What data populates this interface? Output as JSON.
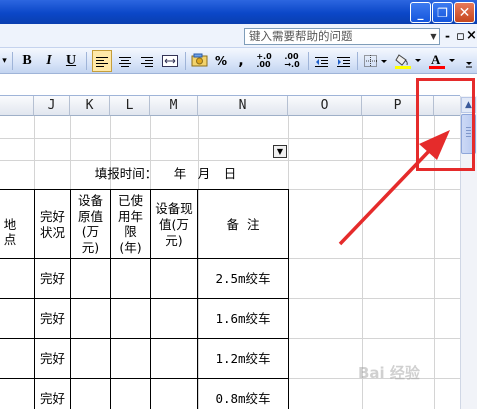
{
  "window": {
    "minimize_glyph": "_",
    "restore_glyph": "❐",
    "close_glyph": "✕"
  },
  "menu": {
    "help_placeholder": "键入需要帮助的问题",
    "help_dropdown": "▼",
    "doc_minimize": "-",
    "doc_restore": "▫",
    "doc_close": "×"
  },
  "toolbar": {
    "left_arrow": "▾",
    "bold": "B",
    "italic": "I",
    "underline": "U",
    "percent": "%",
    "comma": ",",
    "increase_decimal": "+.0\n.00",
    "decrease_decimal": ".00\n→.0",
    "font_color_letter": "A",
    "highlight_color": "#ffff00",
    "font_color": "#ff0000"
  },
  "columns": [
    "J",
    "K",
    "L",
    "M",
    "N",
    "O",
    "P"
  ],
  "sheet": {
    "fill_time_label": "填报时间：",
    "year": "年",
    "month": "月",
    "day": "日",
    "filter_arrow": "▼",
    "headers": {
      "location_fragment": "地点",
      "condition": "完好\n状况",
      "original_value": "设备\n原值\n(万\n元)",
      "years_used": "已使\n用年\n限\n(年)",
      "current_value": "设备现\n值(万\n元)",
      "remarks": "备  注"
    },
    "rows": [
      {
        "condition": "完好",
        "remark": "2.5m绞车"
      },
      {
        "condition": "完好",
        "remark": "1.6m绞车"
      },
      {
        "condition": "完好",
        "remark": "1.2m绞车"
      },
      {
        "condition": "完好",
        "remark": "0.8m绞车"
      }
    ]
  },
  "scrollbar": {
    "up_arrow": "▲"
  },
  "annotation": {
    "color": "#e52b2b"
  },
  "watermark": {
    "text": "Bai 经验"
  }
}
